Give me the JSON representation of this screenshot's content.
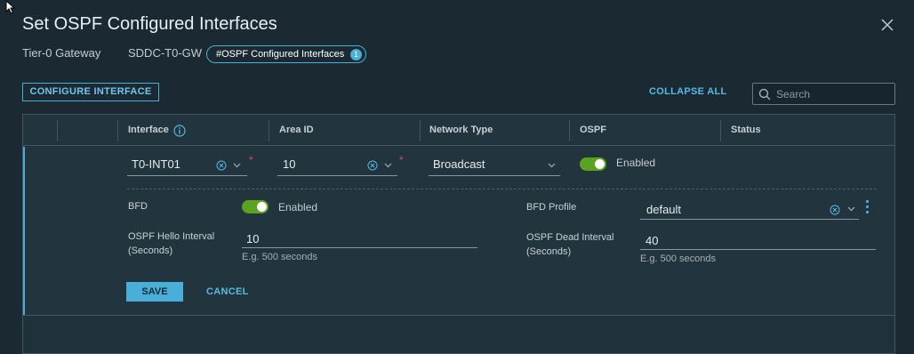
{
  "dialog": {
    "title": "Set OSPF Configured Interfaces"
  },
  "breadcrumb": {
    "gateway_type": "Tier-0 Gateway",
    "gateway_name": "SDDC-T0-GW",
    "pill_label": "#OSPF Configured Interfaces",
    "pill_count": "1"
  },
  "toolbar": {
    "configure_label": "CONFIGURE INTERFACE",
    "collapse_label": "COLLAPSE ALL",
    "search_placeholder": "Search"
  },
  "grid": {
    "columns": [
      "Interface",
      "Area ID",
      "Network Type",
      "OSPF",
      "Status"
    ],
    "row": {
      "interface": "T0-INT01",
      "area_id": "10",
      "network_type": "Broadcast",
      "ospf_state": "Enabled",
      "ospf_enabled": true
    },
    "detail": {
      "bfd_label": "BFD",
      "bfd_state": "Enabled",
      "bfd_enabled": true,
      "bfd_profile_label": "BFD Profile",
      "bfd_profile_value": "default",
      "hello_label_line1": "OSPF Hello Interval",
      "hello_label_line2": "(Seconds)",
      "hello_value": "10",
      "hello_hint": "E.g. 500 seconds",
      "dead_label_line1": "OSPF Dead Interval",
      "dead_label_line2": "(Seconds)",
      "dead_value": "40",
      "dead_hint": "E.g. 500 seconds",
      "save_label": "SAVE",
      "cancel_label": "CANCEL"
    }
  },
  "colors": {
    "accent": "#49afd9",
    "toggle_on": "#5aa220",
    "required": "#e04a3e",
    "background": "#1b2a32"
  },
  "icons": [
    "cursor-icon",
    "close-icon",
    "search-icon",
    "info-icon",
    "clear-icon",
    "chevron-down-icon",
    "kebab-icon"
  ]
}
